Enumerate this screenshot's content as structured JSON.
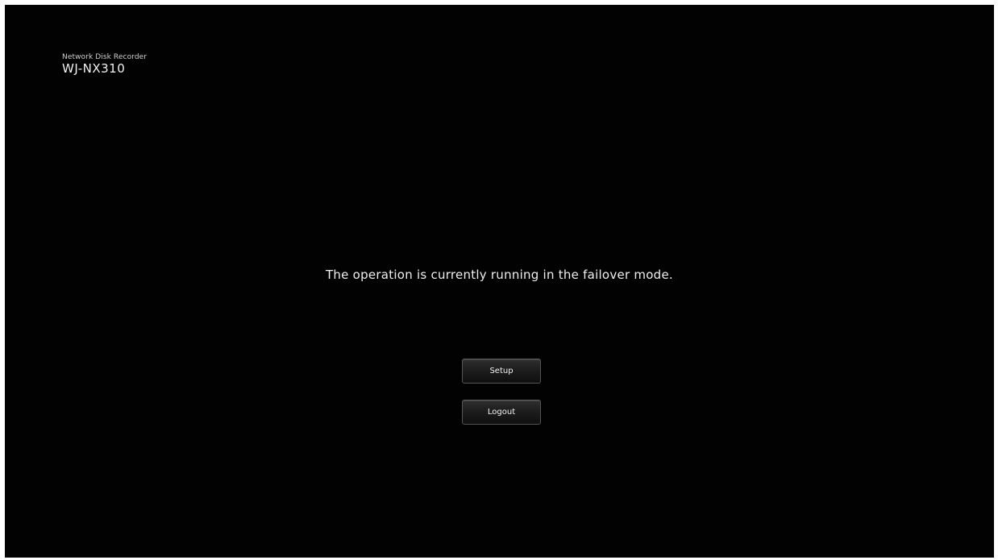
{
  "header": {
    "product_line": "Network Disk Recorder",
    "model": "WJ-NX310"
  },
  "main": {
    "message": "The operation is currently running in the failover mode."
  },
  "buttons": {
    "setup_label": "Setup",
    "logout_label": "Logout"
  },
  "colors": {
    "background": "#020202",
    "text": "#f0f0f0",
    "button_border": "#555555"
  }
}
